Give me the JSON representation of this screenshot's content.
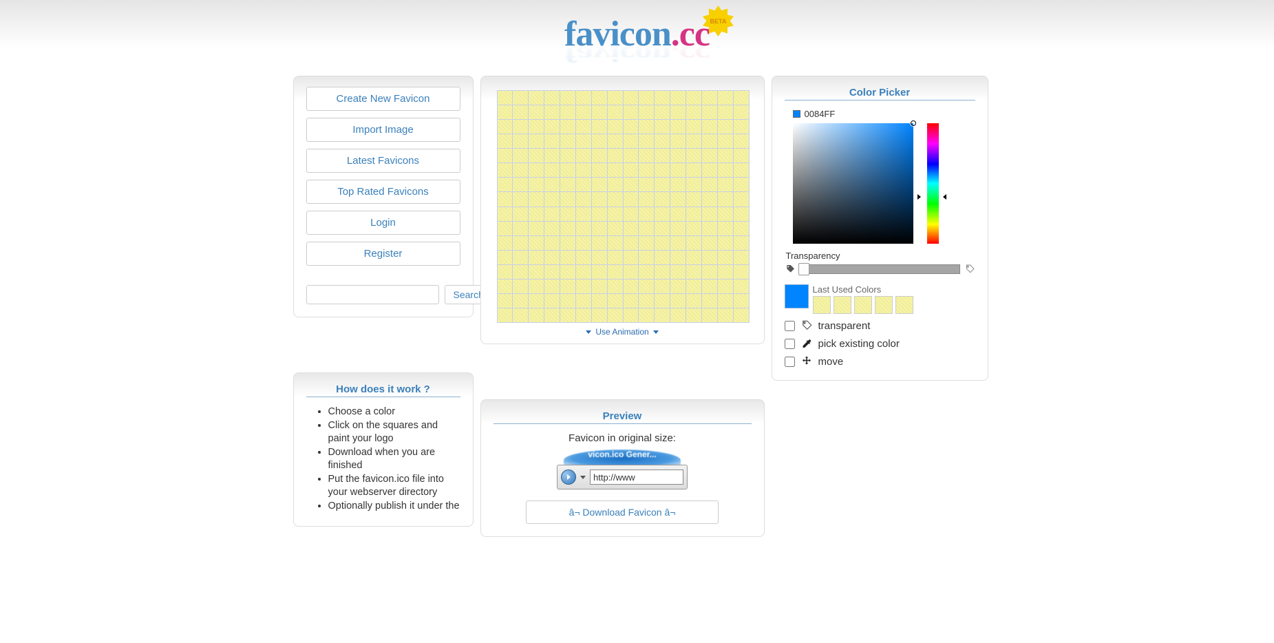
{
  "header": {
    "logo_part1": "favicon",
    "logo_dot": ".",
    "logo_part2": "cc",
    "beta": "BETA"
  },
  "sidebar": {
    "items": [
      "Create New Favicon",
      "Import Image",
      "Latest Favicons",
      "Top Rated Favicons",
      "Login",
      "Register"
    ],
    "search_btn": "Search"
  },
  "editor": {
    "use_animation": "Use Animation"
  },
  "color_picker": {
    "title": "Color Picker",
    "current_hex": "0084FF",
    "transparency_label": "Transparency",
    "last_used_label": "Last Used Colors",
    "tools": {
      "transparent": "transparent",
      "pick": "pick existing color",
      "move": "move"
    }
  },
  "how": {
    "title": "How does it work ?",
    "steps": [
      "Choose a color",
      "Click on the squares and paint your logo",
      "Download when you are finished",
      "Put the favicon.ico file into your webserver directory",
      "Optionally publish it under the"
    ]
  },
  "preview": {
    "title": "Preview",
    "sub": "Favicon in original size:",
    "tab_text": "vicon.ico Gener...",
    "url": "http://www",
    "download": "â¬ Download Favicon â¬"
  }
}
